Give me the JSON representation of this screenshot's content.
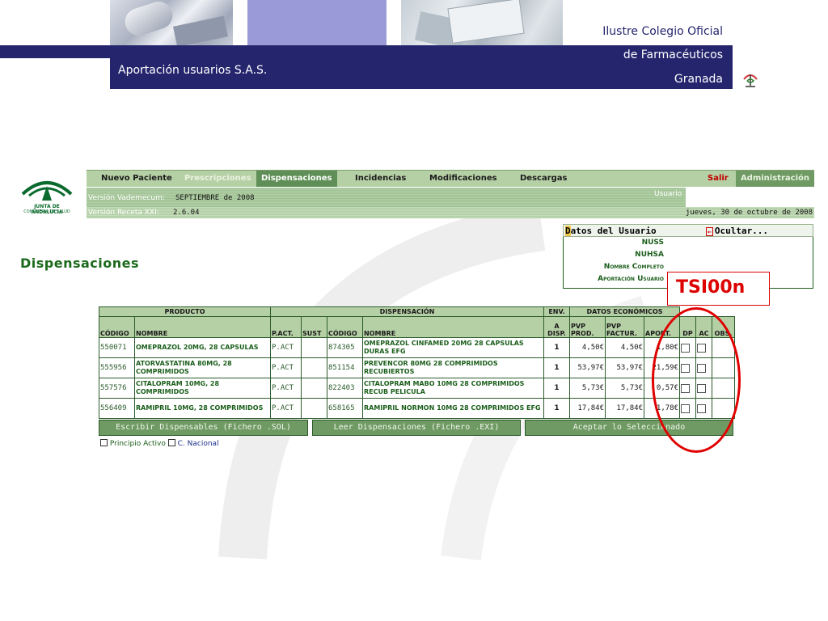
{
  "header": {
    "college_line1": "Ilustre Colegio Oficial",
    "college_line2": "de Farmacéuticos",
    "college_line3": "Granada",
    "app_title": "Aportación usuarios S.A.S."
  },
  "junta": {
    "line1": "JUNTA DE ANDALUCIA",
    "line2": "CONSEJERIA DE SALUD"
  },
  "nav": {
    "items": [
      "Nuevo Paciente",
      "Prescripciones",
      "Dispensaciones",
      "Incidencias",
      "Modificaciones",
      "Descargas"
    ],
    "salir": "Salir",
    "admin": "Administración"
  },
  "info": {
    "vademecum_label": "Versión Vademecum:",
    "vademecum_value": "SEPTIEMBRE de 2008",
    "receta_label": "Versión Receta XXI:",
    "receta_value": "2.6.04",
    "usuario_label": "Usuario",
    "date": "jueves, 30 de octubre de 2008"
  },
  "page_title": "Dispensaciones",
  "user_panel": {
    "title_first": "D",
    "title_rest": "atos del Usuario",
    "hide_arrow": "←",
    "hide_label": "Ocultar...",
    "fields": [
      "NUSS",
      "NUHSA",
      "Nombre Completo",
      "Aportación Usuario"
    ]
  },
  "annotation": {
    "label": "TSI00n"
  },
  "table": {
    "group_headers": [
      "PRODUCTO",
      "DISPENSACIÓN",
      "ENV.",
      "DATOS ECONÓMICOS"
    ],
    "columns": {
      "codigo": "CÓDIGO",
      "nombre": "NOMBRE",
      "pact": "P.ACT.",
      "sust": "SUST",
      "codigo2": "CÓDIGO",
      "nombre2": "NOMBRE",
      "env": "A DISP.",
      "pvp_prod": "PVP PROD.",
      "pvp_fact": "PVP FACTUR.",
      "aport": "APORT.",
      "dp": "DP",
      "ac": "AC",
      "obs": "OBS."
    },
    "rows": [
      {
        "codigo": "550071",
        "nombre": "OMEPRAZOL 20MG, 28 CAPSULAS",
        "pact": "P.ACT",
        "sust": "",
        "codigo2": "874305",
        "nombre2": "OMEPRAZOL CINFAMED 20MG 28 CAPSULAS DURAS EFG",
        "qty": "1",
        "pvp_prod": "4,50€",
        "pvp_fact": "4,50€",
        "aport": "1,80€"
      },
      {
        "codigo": "555956",
        "nombre": "ATORVASTATINA 80MG, 28 COMPRIMIDOS",
        "pact": "P.ACT",
        "sust": "",
        "codigo2": "851154",
        "nombre2": "PREVENCOR 80MG 28 COMPRIMIDOS RECUBIERTOS",
        "qty": "1",
        "pvp_prod": "53,97€",
        "pvp_fact": "53,97€",
        "aport": "21,59€"
      },
      {
        "codigo": "557576",
        "nombre": "CITALOPRAM 10MG, 28 COMPRIMIDOS",
        "pact": "P.ACT",
        "sust": "",
        "codigo2": "822403",
        "nombre2": "CITALOPRAM MABO 10MG 28 COMPRIMIDOS RECUB PELICULA",
        "qty": "1",
        "pvp_prod": "5,73€",
        "pvp_fact": "5,73€",
        "aport": "0,57€"
      },
      {
        "codigo": "556409",
        "nombre": "RAMIPRIL 10MG, 28 COMPRIMIDOS",
        "pact": "P.ACT",
        "sust": "",
        "codigo2": "658165",
        "nombre2": "RAMIPRIL NORMON 10MG 28 COMPRIMIDOS EFG",
        "qty": "1",
        "pvp_prod": "17,84€",
        "pvp_fact": "17,84€",
        "aport": "1,78€"
      }
    ],
    "buttons": [
      "Escribir Dispensables (Fichero .SOL)",
      "Leer Dispensaciones (Fichero .EXI)",
      "Aceptar lo Seleccionado"
    ]
  },
  "options": {
    "principio_activo": "Principio Activo",
    "c_nacional": "C. Nacional"
  },
  "colors": {
    "banner": "#25256e",
    "nav_green": "#b6d0a6",
    "accent_green": "#6f9a63",
    "annotation_red": "#e00000"
  }
}
